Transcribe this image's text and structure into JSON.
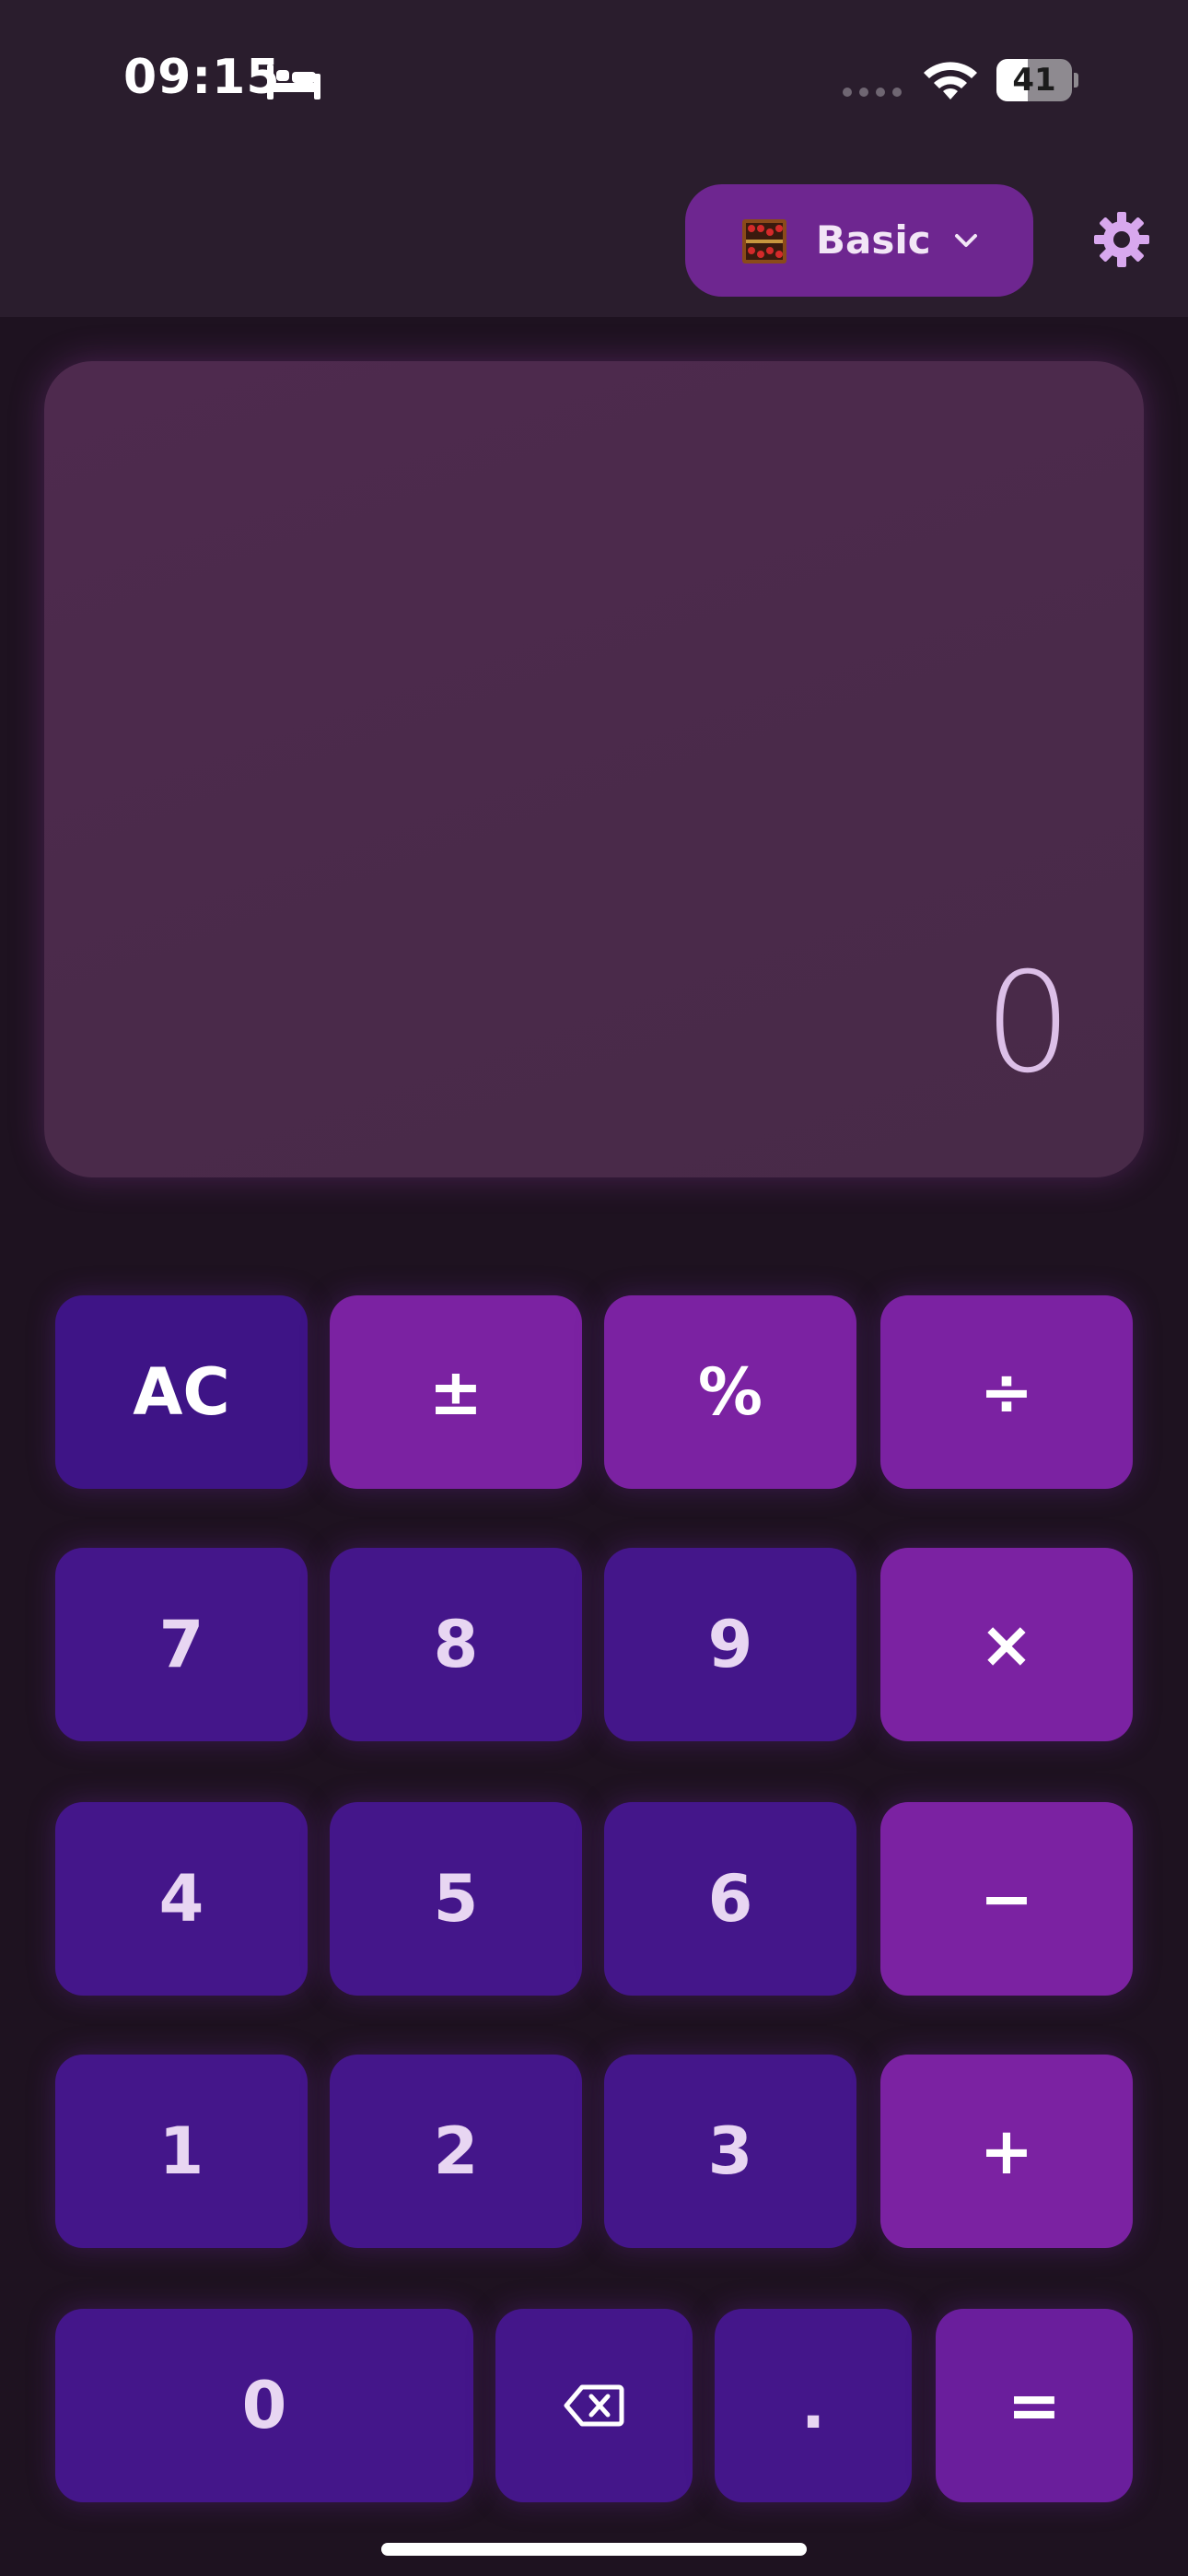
{
  "status_bar": {
    "time": "09:15",
    "battery_level": "41",
    "battery_fraction": 0.41
  },
  "header": {
    "mode_label": "Basic",
    "mode_icon": "abacus-icon",
    "settings_icon": "gear-icon"
  },
  "display": {
    "value": "0"
  },
  "keypad": {
    "ac": "AC",
    "plus_minus": "±",
    "percent": "%",
    "divide": "÷",
    "seven": "7",
    "eight": "8",
    "nine": "9",
    "multiply": "×",
    "four": "4",
    "five": "5",
    "six": "6",
    "minus": "−",
    "one": "1",
    "two": "2",
    "three": "3",
    "plus": "+",
    "zero": "0",
    "backspace_icon": "backspace-icon",
    "decimal": ".",
    "equals": "="
  },
  "colors": {
    "background": "#1e1220",
    "header": "#2a1d2d",
    "display": "#4c2a4c",
    "number_key": "#44168a",
    "operator_key": "#7b22a2",
    "mode_pill": "#6e2690",
    "display_text": "#dcbfe8"
  }
}
